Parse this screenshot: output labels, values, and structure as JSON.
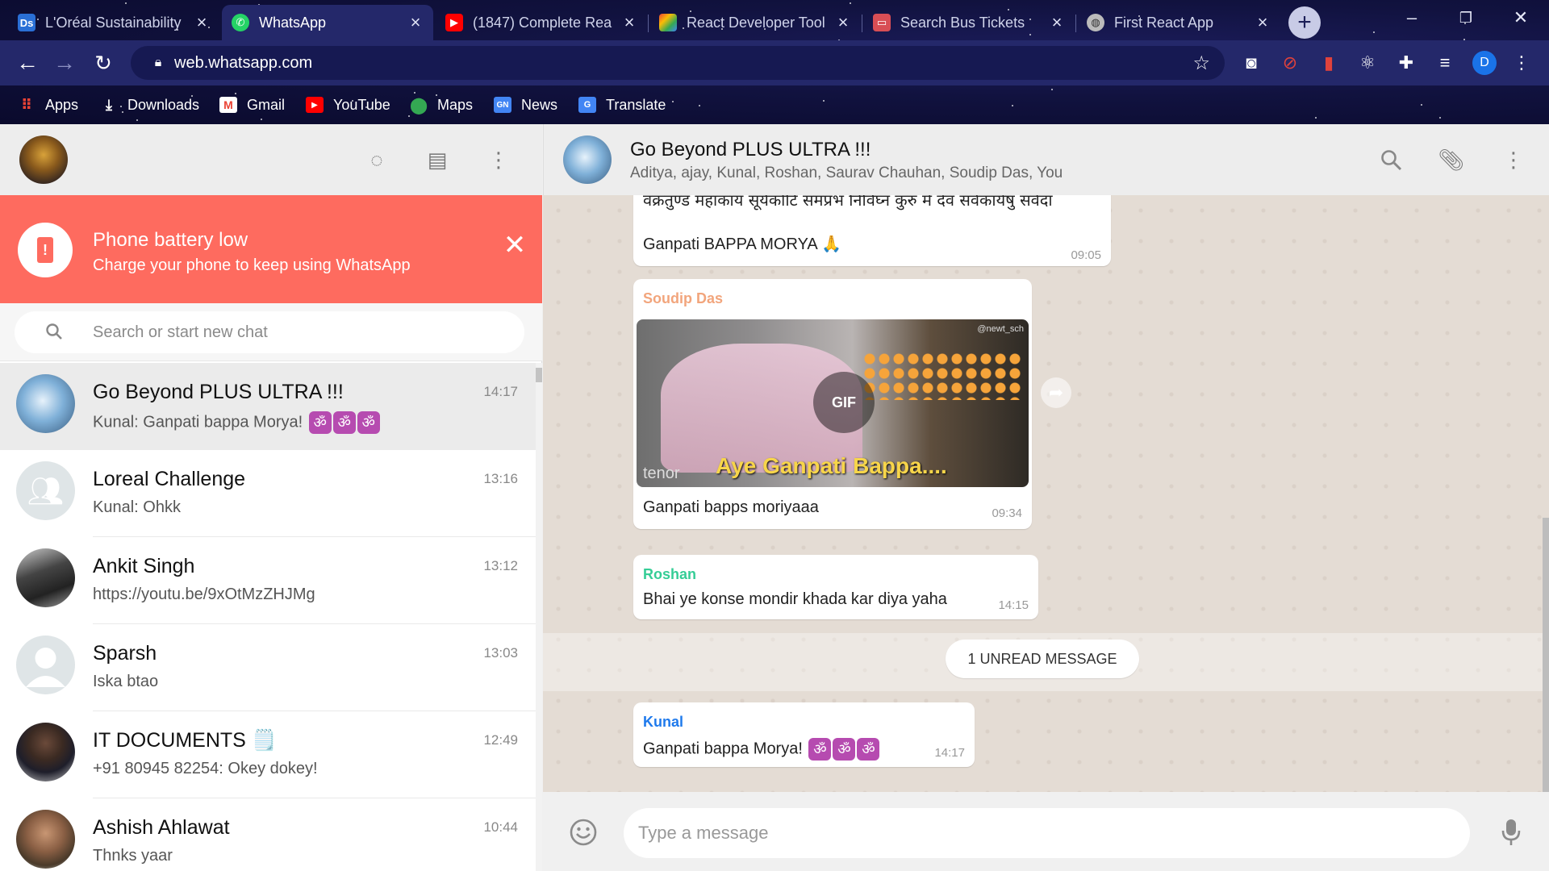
{
  "browser": {
    "tabs": [
      {
        "title": "L'Oréal Sustainability",
        "icon": "loreal-favicon-icon",
        "color": "#2a6fd6"
      },
      {
        "title": "WhatsApp",
        "icon": "whatsapp-favicon-icon",
        "color": "#25d366"
      },
      {
        "title": "(1847) Complete Rea",
        "icon": "youtube-favicon-icon",
        "color": "#ff0000"
      },
      {
        "title": "React Developer Tool",
        "icon": "chrome-webstore-favicon-icon",
        "color": "#4285f4"
      },
      {
        "title": "Search Bus Tickets",
        "icon": "bus-favicon-icon",
        "color": "#d84e55"
      },
      {
        "title": "First React App",
        "icon": "globe-favicon-icon",
        "color": "#bbbbbb"
      }
    ],
    "active_tab": "WhatsApp",
    "url": "web.whatsapp.com",
    "profile_initial": "D",
    "bookmarks": [
      {
        "label": "Apps",
        "icon": "apps-grid-icon"
      },
      {
        "label": "Downloads",
        "icon": "download-icon"
      },
      {
        "label": "Gmail",
        "icon": "gmail-icon"
      },
      {
        "label": "YouTube",
        "icon": "youtube-icon"
      },
      {
        "label": "Maps",
        "icon": "maps-icon"
      },
      {
        "label": "News",
        "icon": "news-icon"
      },
      {
        "label": "Translate",
        "icon": "translate-icon"
      }
    ]
  },
  "alert": {
    "title": "Phone battery low",
    "subtitle": "Charge your phone to keep using WhatsApp",
    "color": "#fe6b5f"
  },
  "search": {
    "placeholder": "Search or start new chat"
  },
  "chats": [
    {
      "name": "Go Beyond PLUS ULTRA !!!",
      "time": "14:17",
      "last": "Kunal: Ganpati bappa Morya!",
      "emoji_count": 3,
      "selected": true
    },
    {
      "name": "Loreal Challenge",
      "time": "13:16",
      "last": "Kunal: Ohkk"
    },
    {
      "name": "Ankit Singh",
      "time": "13:12",
      "last": "https://youtu.be/9xOtMzZHJMg"
    },
    {
      "name": "Sparsh",
      "time": "13:03",
      "last": "Iska btao"
    },
    {
      "name": "IT DOCUMENTS 🗒️",
      "time": "12:49",
      "last": "+91 80945 82254: Okey dokey!"
    },
    {
      "name": "Ashish Ahlawat",
      "time": "10:44",
      "last": "Thnks yaar"
    }
  ],
  "conversation": {
    "group_name": "Go Beyond PLUS ULTRA !!!",
    "members": "Aditya, ajay, Kunal, Roshan, Saurav Chauhan, Soudip Das, You",
    "messages": [
      {
        "id": "m1",
        "text_hindi": "वक्रतुण्ड महाकाय सूर्यकोटि समप्रभ निर्विघ्नं कुरु मे देव सर्वकार्येषु सर्वदा",
        "text": "Ganpati BAPPA MORYA 🙏",
        "time": "09:05"
      },
      {
        "id": "m2",
        "sender": "Soudip Das",
        "sender_color": "#f2a57c",
        "gif_badge": "GIF",
        "gif_caption": "Aye Ganpati Bappa....",
        "gif_source": "tenor",
        "gif_handle": "@newt_sch",
        "text": "Ganpati bapps moriyaaa",
        "time": "09:34"
      },
      {
        "id": "m3",
        "sender": "Roshan",
        "sender_color": "#35cd96",
        "text": "Bhai ye konse mondir khada kar diya yaha",
        "time": "14:15"
      },
      {
        "id": "m4",
        "sender": "Kunal",
        "sender_color": "#1f7aec",
        "text": "Ganpati bappa Morya!",
        "emoji_count": 3,
        "time": "14:17"
      }
    ],
    "unread_label": "1 UNREAD MESSAGE"
  },
  "composer": {
    "placeholder": "Type a message"
  }
}
